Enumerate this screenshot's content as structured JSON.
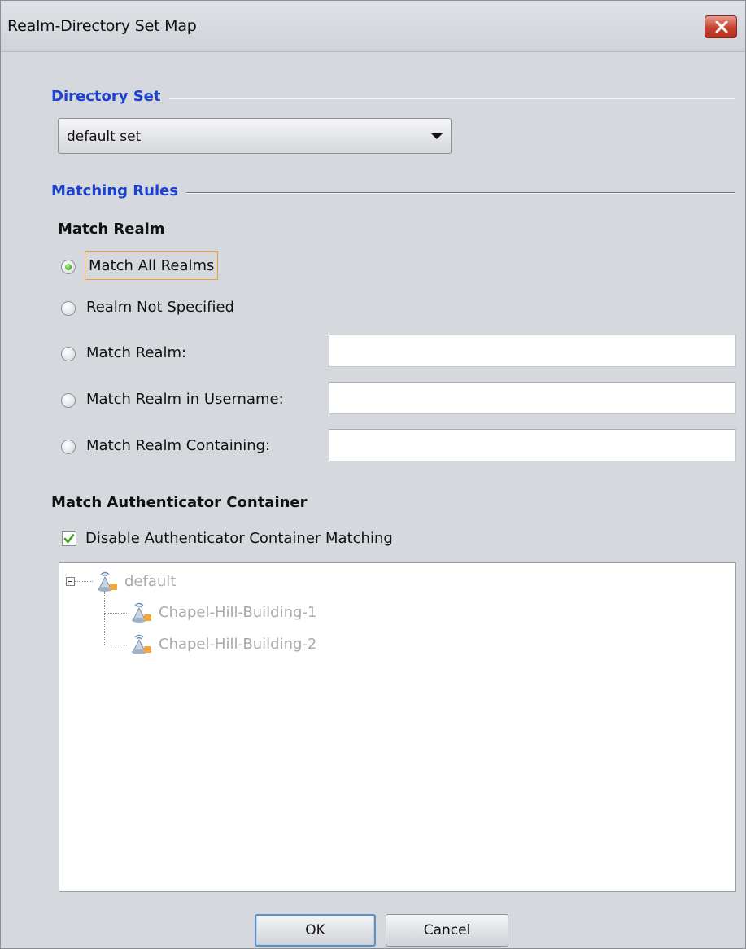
{
  "window": {
    "title": "Realm-Directory Set Map"
  },
  "directory_set": {
    "section_title": "Directory Set",
    "selected": "default set"
  },
  "matching_rules": {
    "section_title": "Matching Rules",
    "match_realm": {
      "label": "Match Realm",
      "options": [
        {
          "label": "Match All Realms",
          "checked": true
        },
        {
          "label": "Realm Not Specified",
          "checked": false
        },
        {
          "label": "Match Realm:",
          "checked": false,
          "value": ""
        },
        {
          "label": "Match Realm in Username:",
          "checked": false,
          "value": ""
        },
        {
          "label": "Match Realm Containing:",
          "checked": false,
          "value": ""
        }
      ]
    },
    "authenticator": {
      "label": "Match Authenticator Container",
      "disable_checkbox": {
        "label": "Disable Authenticator Container Matching",
        "checked": true
      },
      "tree": {
        "root": "default",
        "children": [
          "Chapel-Hill-Building-1",
          "Chapel-Hill-Building-2"
        ]
      }
    }
  },
  "buttons": {
    "ok": "OK",
    "cancel": "Cancel"
  },
  "colors": {
    "section_title": "#1a41cf",
    "focus": "#f1a129",
    "check": "#3aa51a",
    "disabled_text": "#a7aaae"
  }
}
